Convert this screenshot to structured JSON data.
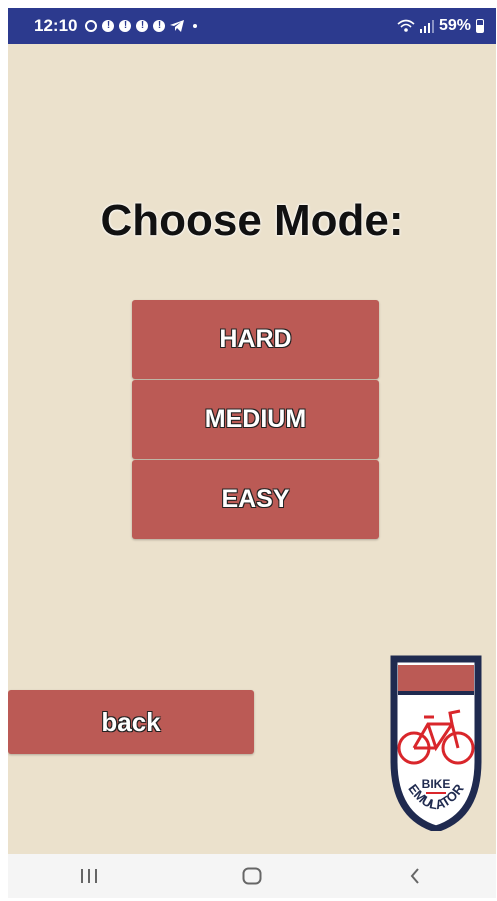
{
  "status_bar": {
    "time": "12:10",
    "battery": "59%"
  },
  "title": "Choose Mode:",
  "modes": [
    {
      "label": "HARD"
    },
    {
      "label": "MEDIUM"
    },
    {
      "label": "EASY"
    }
  ],
  "back_label": "back",
  "logo": {
    "line1": "BIKE",
    "line2": "EMULATOR"
  },
  "icons": {
    "whatsapp": "whatsapp-icon",
    "notification": "alert-icon",
    "telegram": "telegram-icon",
    "wifi": "wifi-icon",
    "signal": "signal-icon",
    "battery": "battery-icon",
    "recents": "recents-icon",
    "home": "home-icon",
    "back": "back-icon"
  },
  "colors": {
    "status_bar": "#2c3a8e",
    "background": "#ebe1cc",
    "button": "#bb5a55",
    "logo_border": "#1f2a4f",
    "logo_bike": "#d9262b"
  }
}
